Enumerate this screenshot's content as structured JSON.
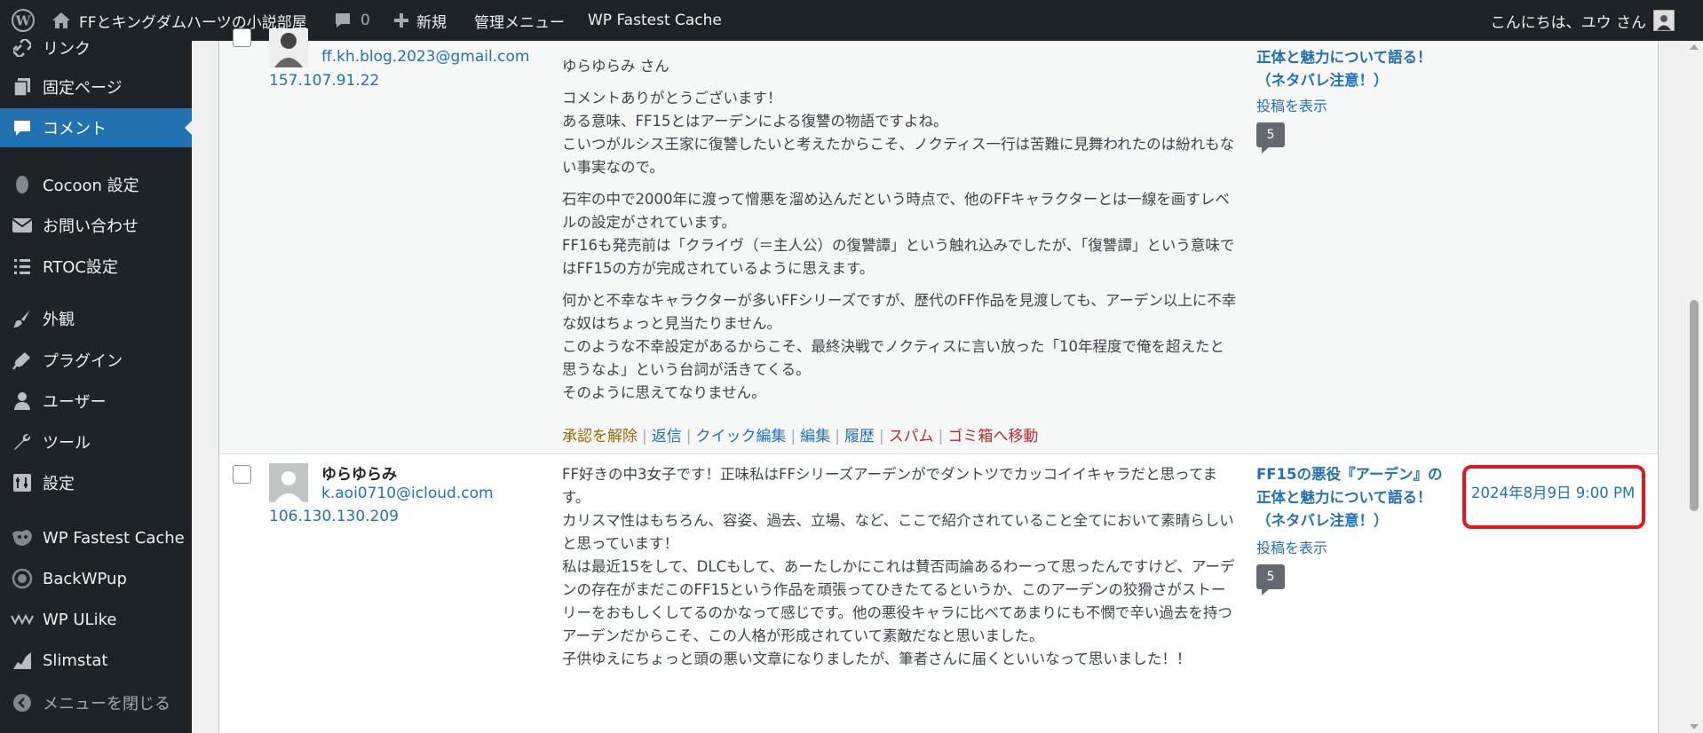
{
  "admin_bar": {
    "wp_logo_icon": "wordpress-icon",
    "site_icon": "home-icon",
    "site_name": "FFとキングダムハーツの小説部屋",
    "comments_icon": "comment-bubble-icon",
    "comments_count": "0",
    "new_icon": "plus-icon",
    "new_label": "新規",
    "admin_menu_label": "管理メニュー",
    "cache_label": "WP Fastest Cache",
    "greeting": "こんにちは、ユウ さん"
  },
  "sidebar": {
    "items": [
      {
        "label": "リンク",
        "icon": "link-icon"
      },
      {
        "label": "固定ページ",
        "icon": "page-icon"
      },
      {
        "label": "コメント",
        "icon": "comment-icon"
      },
      {
        "label": "Cocoon 設定",
        "icon": "cocoon-icon"
      },
      {
        "label": "お問い合わせ",
        "icon": "mail-icon"
      },
      {
        "label": "RTOC設定",
        "icon": "list-icon"
      },
      {
        "label": "外観",
        "icon": "brush-icon"
      },
      {
        "label": "プラグイン",
        "icon": "plugin-icon"
      },
      {
        "label": "ユーザー",
        "icon": "user-icon"
      },
      {
        "label": "ツール",
        "icon": "wrench-icon"
      },
      {
        "label": "設定",
        "icon": "settings-icon"
      },
      {
        "label": "WP Fastest Cache",
        "icon": "cheetah-icon"
      },
      {
        "label": "BackWPup",
        "icon": "backup-icon"
      },
      {
        "label": "WP ULike",
        "icon": "ulike-icon"
      },
      {
        "label": "Slimstat",
        "icon": "chart-icon"
      },
      {
        "label": "メニューを閉じる",
        "icon": "collapse-icon"
      }
    ]
  },
  "comments": [
    {
      "author_email": "ff.kh.blog.2023@gmail.com",
      "author_ip": "157.107.91.22",
      "paragraphs": [
        "ゆらゆらみ さん",
        "コメントありがとうございます！\nある意味、FF15とはアーデンによる復讐の物語ですよね。\nこいつがルシス王家に復讐したいと考えたからこそ、ノクティス一行は苦難に見舞われたのは紛れもない事実なので。",
        "石牢の中で2000年に渡って憎悪を溜め込んだという時点で、他のFFキャラクターとは一線を画すレベルの設定がされています。\nFF16も発売前は「クライヴ（＝主人公）の復讐譚」という触れ込みでしたが、「復讐譚」という意味ではFF15の方が完成されているように思えます。",
        "何かと不幸なキャラクターが多いFFシリーズですが、歴代のFF作品を見渡しても、アーデン以上に不幸な奴はちょっと見当たりません。\nこのような不幸設定があるからこそ、最終決戦でノクティスに言い放った「10年程度で俺を超えたと思うなよ」という台詞が活きてくる。\nそのように思えてなりません。"
      ],
      "actions": [
        "承認を解除",
        "返信",
        "クイック編集",
        "編集",
        "履歴",
        "スパム",
        "ゴミ箱へ移動"
      ],
      "post_title": "正体と魅力について語る！（ネタバレ注意！）",
      "view_post": "投稿を表示",
      "comment_count": "5"
    },
    {
      "author_name": "ゆらゆらみ",
      "author_email": "k.aoi0710@icloud.com",
      "author_ip": "106.130.130.209",
      "paragraphs": [
        "FF好きの中3女子です！正味私はFFシリーズアーデンがでダントツでカッコイイキャラだと思ってます。\nカリスマ性はもちろん、容姿、過去、立場、など、ここで紹介されていること全てにおいて素晴らしいと思っています！\n私は最近15をして、DLCもして、あーたしかにこれは賛否両論あるわーって思ったんですけど、アーデンの存在がまだこのFF15という作品を頑張ってひきたてるというか、このアーデンの狡猾さがストーリーをおもしくしてるのかなって感じです。他の悪役キャラに比べてあまりにも不憫で辛い過去を持つアーデンだからこそ、この人格が形成されていて素敵だなと思いました。\n子供ゆえにちょっと頭の悪い文章になりましたが、筆者さんに届くといいなって思いました！！"
      ],
      "post_title": "FF15の悪役『アーデン』の正体と魅力について語る！（ネタバレ注意！）",
      "view_post": "投稿を表示",
      "comment_count": "5",
      "date": "2024年8月9日 9:00 PM"
    }
  ],
  "colors": {
    "admin_bar_bg": "#1d2327",
    "accent": "#2271b1",
    "highlight_box": "#e8141c",
    "unapprove": "#996800",
    "danger": "#b32d2e"
  }
}
